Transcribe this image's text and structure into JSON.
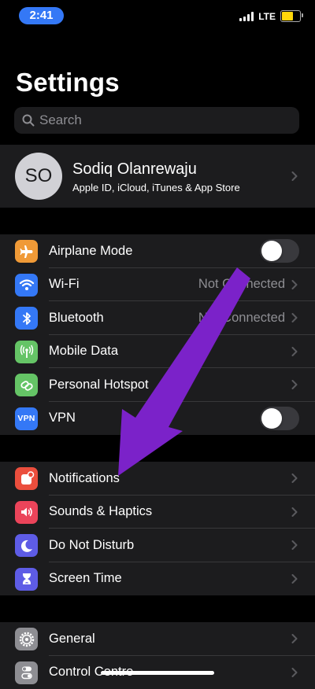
{
  "status_bar": {
    "time": "2:41",
    "network": "LTE"
  },
  "title": "Settings",
  "search": {
    "placeholder": "Search"
  },
  "profile": {
    "initials": "SO",
    "name": "Sodiq Olanrewaju",
    "subtitle": "Apple ID, iCloud, iTunes & App Store"
  },
  "groups": [
    [
      {
        "label": "Airplane Mode",
        "icon": "airplane-icon",
        "color": "#f09a37",
        "control": "toggle",
        "on": false
      },
      {
        "label": "Wi-Fi",
        "icon": "wifi-icon",
        "color": "#3478f6",
        "value": "Not Connected"
      },
      {
        "label": "Bluetooth",
        "icon": "bluetooth-icon",
        "color": "#3478f6",
        "value": "Not Connected"
      },
      {
        "label": "Mobile Data",
        "icon": "antenna-icon",
        "color": "#65c466"
      },
      {
        "label": "Personal Hotspot",
        "icon": "link-icon",
        "color": "#65c466"
      },
      {
        "label": "VPN",
        "icon": "vpn-icon",
        "color": "#3478f6",
        "control": "toggle",
        "on": false,
        "icon_text": "VPN"
      }
    ],
    [
      {
        "label": "Notifications",
        "icon": "notifications-icon",
        "color": "#eb4e3d"
      },
      {
        "label": "Sounds & Haptics",
        "icon": "speaker-icon",
        "color": "#eb445a"
      },
      {
        "label": "Do Not Disturb",
        "icon": "moon-icon",
        "color": "#5e5ce6"
      },
      {
        "label": "Screen Time",
        "icon": "hourglass-icon",
        "color": "#5e5ce6"
      }
    ],
    [
      {
        "label": "General",
        "icon": "gear-icon",
        "color": "#8e8e93"
      },
      {
        "label": "Control Centre",
        "icon": "switches-icon",
        "color": "#8e8e93"
      }
    ]
  ],
  "annotation_color": "#7b22c9"
}
